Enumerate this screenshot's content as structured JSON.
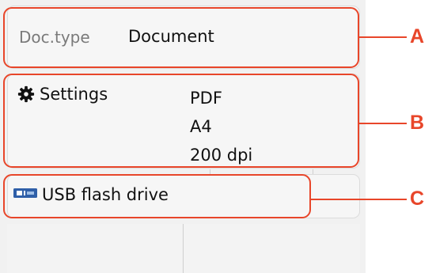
{
  "doc_type": {
    "label": "Doc.type",
    "value": "Document"
  },
  "settings": {
    "label": "Settings",
    "icon": "gear-icon",
    "values": [
      "PDF",
      "A4",
      "200 dpi"
    ]
  },
  "destination": {
    "label": "USB flash drive",
    "icon": "usb-drive-icon"
  },
  "callouts": {
    "a": "A",
    "b": "B",
    "c": "C",
    "color": "#e8462a"
  }
}
